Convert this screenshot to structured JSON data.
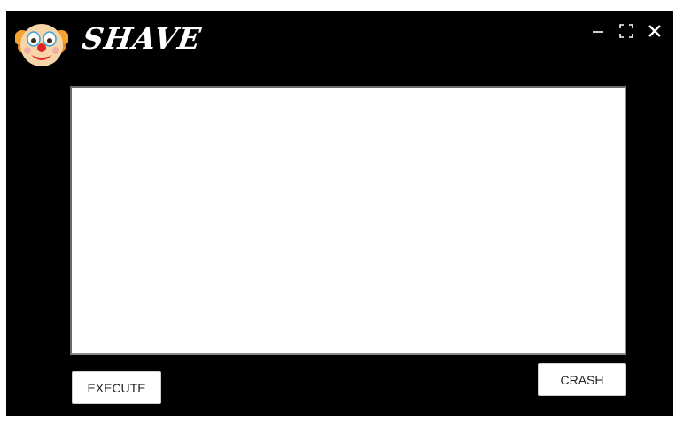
{
  "app": {
    "title": "SHAVE",
    "logo_icon": "clown-face-icon"
  },
  "window_controls": {
    "minimize_icon": "minimize-icon",
    "maximize_icon": "maximize-icon",
    "close_icon": "close-icon"
  },
  "editor": {
    "value": "",
    "placeholder": ""
  },
  "buttons": {
    "execute_label": "EXECUTE",
    "crash_label": "CRASH"
  },
  "colors": {
    "background": "#000000",
    "editor_bg": "#ffffff",
    "button_bg": "#ffffff",
    "title_text": "#ffffff"
  }
}
